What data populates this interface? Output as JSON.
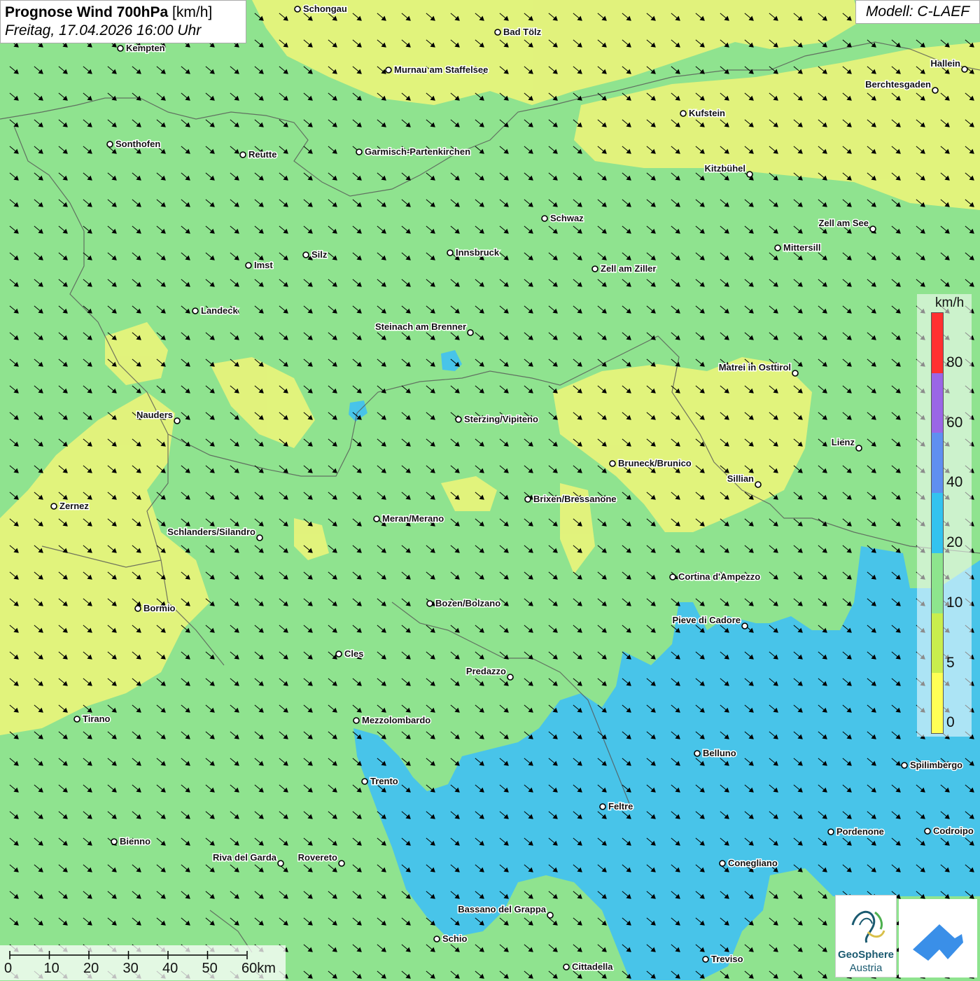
{
  "title": {
    "param": "Prognose Wind 700hPa",
    "unit": "[km/h]",
    "datetime": "Freitag, 17.04.2026 16:00 Uhr"
  },
  "model": "Modell: C-LAEF",
  "legend": {
    "unit": "km/h",
    "ticks": [
      "80",
      "60",
      "40",
      "20",
      "10",
      "5",
      "0"
    ],
    "colors": [
      "#ff3030",
      "#9a66e6",
      "#5f8ff0",
      "#33c3ef",
      "#8de58d",
      "#c9ee4d",
      "#ffff55"
    ]
  },
  "background_colors": {
    "green": "#8fe38f",
    "yellow": "#e8f27a",
    "blue": "#45c2ee",
    "border": "#555555"
  },
  "wind": {
    "direction": "from north-west",
    "dominant_speed": "10-20 km/h"
  },
  "cities": [
    {
      "name": "Schongau"
    },
    {
      "name": "Bad Tölz"
    },
    {
      "name": "Kempten"
    },
    {
      "name": "Murnau am Staffelsee"
    },
    {
      "name": "Hallein"
    },
    {
      "name": "Berchtesgaden"
    },
    {
      "name": "Kufstein"
    },
    {
      "name": "Sonthofen"
    },
    {
      "name": "Reutte"
    },
    {
      "name": "Garmisch-Partenkirchen"
    },
    {
      "name": "Kitzbühel"
    },
    {
      "name": "Schwaz"
    },
    {
      "name": "Zell am See"
    },
    {
      "name": "Mittersill"
    },
    {
      "name": "Innsbruck"
    },
    {
      "name": "Silz"
    },
    {
      "name": "Imst"
    },
    {
      "name": "Zell am Ziller"
    },
    {
      "name": "Landeck"
    },
    {
      "name": "Steinach am Brenner"
    },
    {
      "name": "Matrei in Osttirol"
    },
    {
      "name": "Nauders"
    },
    {
      "name": "Sterzing/Vipiteno"
    },
    {
      "name": "Lienz"
    },
    {
      "name": "Bruneck/Brunico"
    },
    {
      "name": "Sillian"
    },
    {
      "name": "Brixen/Bressanone"
    },
    {
      "name": "Zernez"
    },
    {
      "name": "Meran/Merano"
    },
    {
      "name": "Schlanders/Silandro"
    },
    {
      "name": "Cortina d'Ampezzo"
    },
    {
      "name": "Bozen/Bolzano"
    },
    {
      "name": "Bormio"
    },
    {
      "name": "Pieve di Cadore"
    },
    {
      "name": "Cles"
    },
    {
      "name": "Predazzo"
    },
    {
      "name": "Tirano"
    },
    {
      "name": "Mezzolombardo"
    },
    {
      "name": "Belluno"
    },
    {
      "name": "Spilimbergo"
    },
    {
      "name": "Trento"
    },
    {
      "name": "Feltre"
    },
    {
      "name": "Pordenone"
    },
    {
      "name": "Codroipo"
    },
    {
      "name": "Bienno"
    },
    {
      "name": "Riva del Garda"
    },
    {
      "name": "Rovereto"
    },
    {
      "name": "Conegliano"
    },
    {
      "name": "Bassano del Grappa"
    },
    {
      "name": "Schio"
    },
    {
      "name": "Treviso"
    },
    {
      "name": "Cittadella"
    }
  ],
  "scale": {
    "labels": [
      "0",
      "10",
      "20",
      "30",
      "40",
      "50",
      "60km"
    ]
  },
  "logos": {
    "geosphere_line1": "GeoSphere",
    "geosphere_line2": "Austria"
  }
}
